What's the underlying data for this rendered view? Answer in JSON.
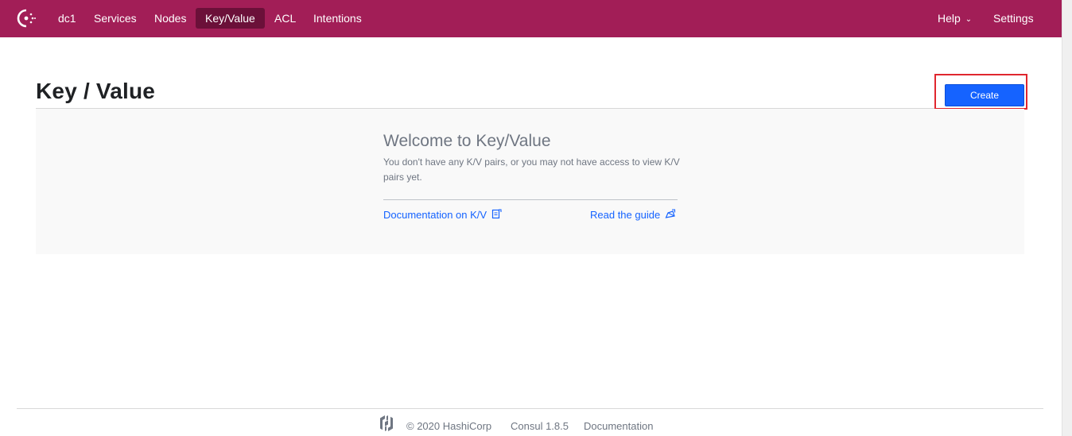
{
  "nav": {
    "datacenter": "dc1",
    "items": [
      "Services",
      "Nodes",
      "Key/Value",
      "ACL",
      "Intentions"
    ],
    "active": "Key/Value",
    "help_label": "Help",
    "settings_label": "Settings"
  },
  "header": {
    "title": "Key / Value",
    "create_label": "Create"
  },
  "empty_state": {
    "title": "Welcome to Key/Value",
    "body": "You don't have any K/V pairs, or you may not have access to view K/V pairs yet.",
    "doc_link": "Documentation on K/V",
    "guide_link": "Read the guide"
  },
  "footer": {
    "copyright": "© 2020 HashiCorp",
    "version": "Consul 1.8.5",
    "docs": "Documentation"
  },
  "colors": {
    "brand": "#a21e57",
    "active_nav": "#6b1039",
    "primary": "#1563ff",
    "highlight": "#e0262e"
  },
  "icons": [
    "consul-logo-icon",
    "chevron-down-icon",
    "document-icon",
    "guide-icon",
    "hashicorp-logo-icon"
  ]
}
